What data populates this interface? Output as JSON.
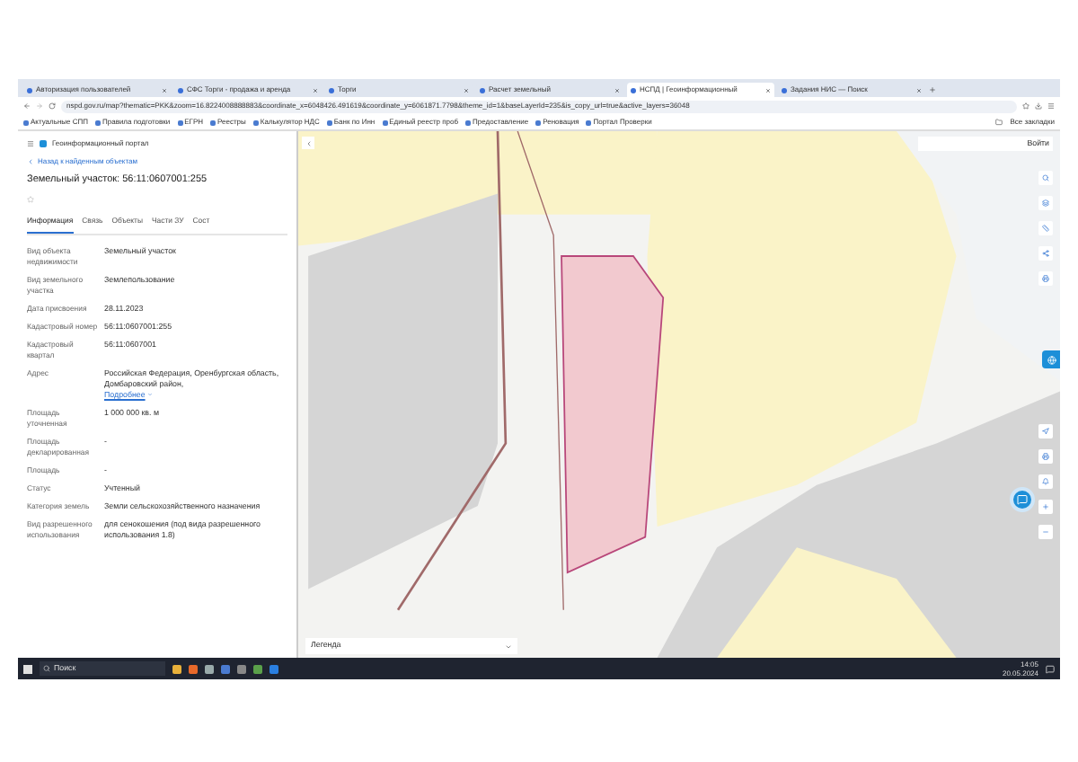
{
  "browser": {
    "tabs": [
      {
        "title": "Авторизация пользователей",
        "selected": false
      },
      {
        "title": "СФС Торги - продажа и аренда",
        "selected": false
      },
      {
        "title": "Торги",
        "selected": false
      },
      {
        "title": "Расчет земельный",
        "selected": false
      },
      {
        "title": "НСПД | Геоинформационный",
        "selected": true
      },
      {
        "title": "Задания НИС — Поиск",
        "selected": false
      }
    ],
    "address": "nspd.gov.ru/map?thematic=PKK&zoom=16.8224008888883&coordinate_x=6048426.491619&coordinate_y=6061871.7798&theme_id=1&baseLayerId=235&is_copy_url=true&active_layers=36048",
    "bookmarks": [
      "Актуальные СПП",
      "Правила подготовки",
      "ЕГРН",
      "Реестры",
      "Калькулятор НДС",
      "Банк по Инн",
      "Единый реестр проб",
      "Предоставление",
      "Реновация",
      "Портал Проверки"
    ],
    "bookmarks_folder": "Все закладки"
  },
  "panel": {
    "portal_title": "Геоинформационный портал",
    "back_link": "Назад к найденным объектам",
    "object_title": "Земельный участок: 56:11:0607001:255",
    "tabs": [
      {
        "label": "Информация",
        "selected": true
      },
      {
        "label": "Связь",
        "selected": false
      },
      {
        "label": "Объекты",
        "selected": false
      },
      {
        "label": "Части ЗУ",
        "selected": false
      },
      {
        "label": "Сост",
        "selected": false
      }
    ],
    "rows": [
      {
        "label": "Вид объекта недвижимости",
        "value": "Земельный участок"
      },
      {
        "label": "Вид земельного участка",
        "value": "Землепользование"
      },
      {
        "label": "Дата присвоения",
        "value": "28.11.2023"
      },
      {
        "label": "Кадастровый номер",
        "value": "56:11:0607001:255"
      },
      {
        "label": "Кадастровый квартал",
        "value": "56:11:0607001"
      },
      {
        "label": "Адрес",
        "value": "Российская Федерация, Оренбургская область, Домбаровский район,",
        "link": "Подробнее"
      },
      {
        "label": "Площадь уточненная",
        "value": "1 000 000 кв. м"
      },
      {
        "label": "Площадь декларированная",
        "value": "-"
      },
      {
        "label": "Площадь",
        "value": "-"
      },
      {
        "label": "Статус",
        "value": "Учтенный"
      },
      {
        "label": "Категория земель",
        "value": "Земли сельскохозяйственного назначения"
      },
      {
        "label": "Вид разрешенного использования",
        "value": "для сенокошения (под вида разрешенного использования 1.8)"
      }
    ]
  },
  "map": {
    "login": "Войти",
    "legend": "Легенда"
  },
  "taskbar": {
    "search": "Поиск",
    "time": "14:05",
    "date": "20.05.2024"
  }
}
